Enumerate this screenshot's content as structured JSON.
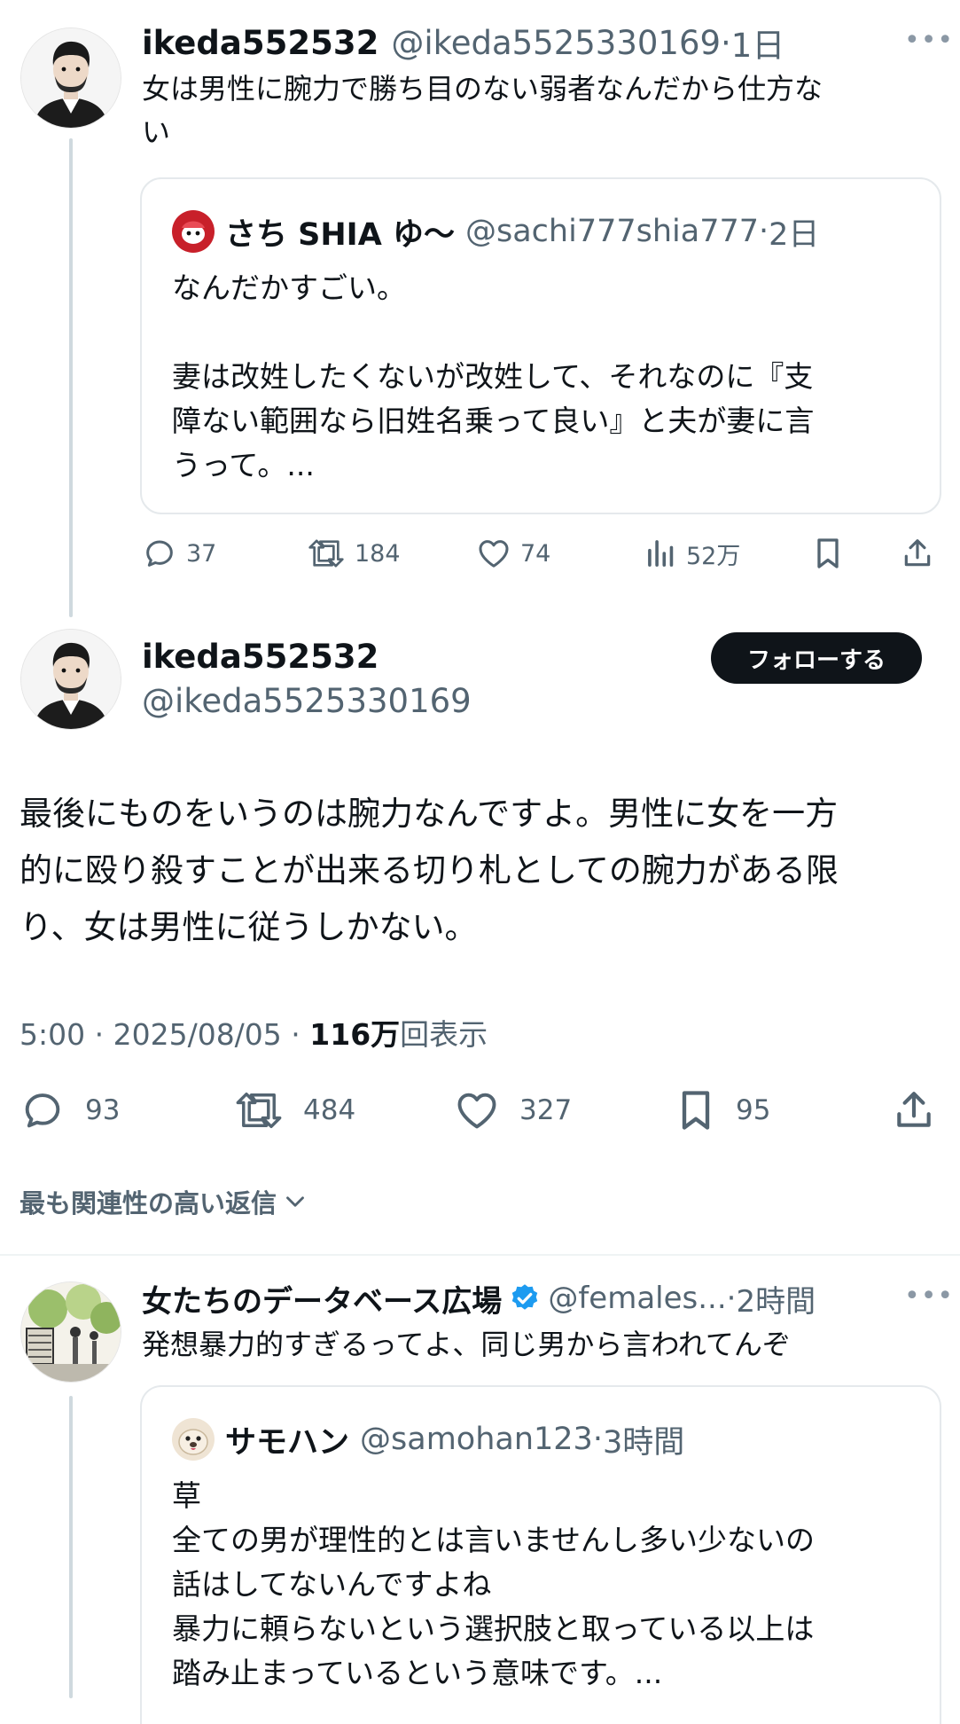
{
  "tweet1": {
    "name": "ikeda552532",
    "handle": "@ikeda5525330169",
    "time": "1日",
    "text": "女は男性に腕力で勝ち目のない弱者なんだから仕方な\nい",
    "quote": {
      "name": "さち SHIA ゆ〜",
      "handle": "@sachi777shia777",
      "time": "2日",
      "text": "なんだかすごい。\n\n妻は改姓したくないが改姓して、それなのに『支\n障ない範囲なら旧姓名乗って良い』と夫が妻に言\nうって。..."
    },
    "actions": {
      "replies": "37",
      "reposts": "184",
      "likes": "74",
      "views": "52万"
    }
  },
  "main": {
    "name": "ikeda552532",
    "handle": "@ikeda5525330169",
    "follow_label": "フォローする",
    "text": "最後にものをいうのは腕力なんですよ。男性に女を一方\n的に殴り殺すことが出来る切り札としての腕力がある限\nり、女は男性に従うしかない。",
    "time": "5:00",
    "date": "2025/08/05",
    "views": "116万",
    "views_label": "回表示",
    "actions": {
      "replies": "93",
      "reposts": "484",
      "likes": "327",
      "bookmarks": "95"
    }
  },
  "sort_label": "最も関連性の高い返信",
  "reply1": {
    "name": "女たちのデータベース広場",
    "handle": "@females...",
    "time": "2時間",
    "text": "発想暴力的すぎるってよ、同じ男から言われてんぞ",
    "quote": {
      "name": "サモハン",
      "handle": "@samohan123",
      "time": "3時間",
      "text": "草\n全ての男が理性的とは言いませんし多い少ないの\n話はしてないんですよね\n暴力に頼らないという選択肢と取っている以上は\n踏み止まっているという意味です。..."
    }
  },
  "colors": {
    "text": "#0f1419",
    "secondary": "#536471",
    "verified": "#1d9bf0",
    "border": "#e5e9ec"
  }
}
